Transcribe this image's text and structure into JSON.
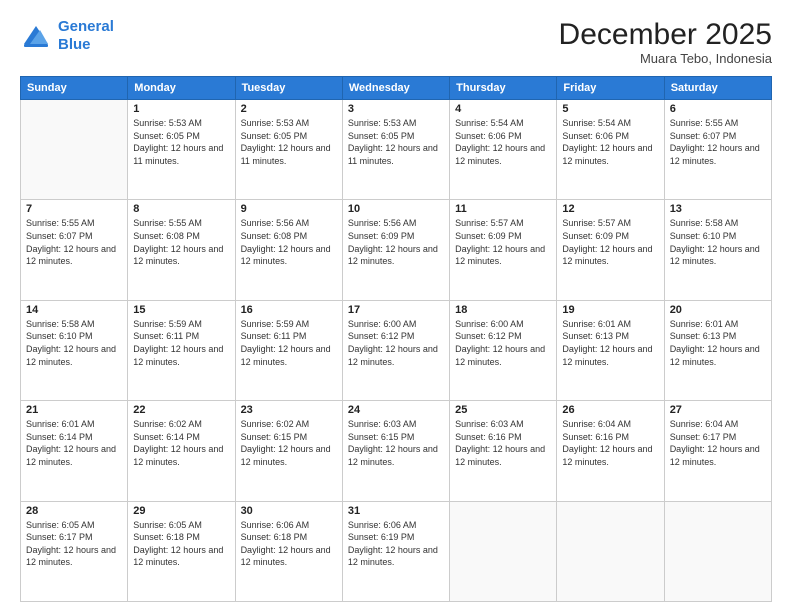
{
  "header": {
    "logo_line1": "General",
    "logo_line2": "Blue",
    "main_title": "December 2025",
    "subtitle": "Muara Tebo, Indonesia"
  },
  "calendar": {
    "days_of_week": [
      "Sunday",
      "Monday",
      "Tuesday",
      "Wednesday",
      "Thursday",
      "Friday",
      "Saturday"
    ],
    "weeks": [
      [
        {
          "day": "",
          "sunrise": "",
          "sunset": "",
          "daylight": ""
        },
        {
          "day": "1",
          "sunrise": "Sunrise: 5:53 AM",
          "sunset": "Sunset: 6:05 PM",
          "daylight": "Daylight: 12 hours and 11 minutes."
        },
        {
          "day": "2",
          "sunrise": "Sunrise: 5:53 AM",
          "sunset": "Sunset: 6:05 PM",
          "daylight": "Daylight: 12 hours and 11 minutes."
        },
        {
          "day": "3",
          "sunrise": "Sunrise: 5:53 AM",
          "sunset": "Sunset: 6:05 PM",
          "daylight": "Daylight: 12 hours and 11 minutes."
        },
        {
          "day": "4",
          "sunrise": "Sunrise: 5:54 AM",
          "sunset": "Sunset: 6:06 PM",
          "daylight": "Daylight: 12 hours and 12 minutes."
        },
        {
          "day": "5",
          "sunrise": "Sunrise: 5:54 AM",
          "sunset": "Sunset: 6:06 PM",
          "daylight": "Daylight: 12 hours and 12 minutes."
        },
        {
          "day": "6",
          "sunrise": "Sunrise: 5:55 AM",
          "sunset": "Sunset: 6:07 PM",
          "daylight": "Daylight: 12 hours and 12 minutes."
        }
      ],
      [
        {
          "day": "7",
          "sunrise": "Sunrise: 5:55 AM",
          "sunset": "Sunset: 6:07 PM",
          "daylight": "Daylight: 12 hours and 12 minutes."
        },
        {
          "day": "8",
          "sunrise": "Sunrise: 5:55 AM",
          "sunset": "Sunset: 6:08 PM",
          "daylight": "Daylight: 12 hours and 12 minutes."
        },
        {
          "day": "9",
          "sunrise": "Sunrise: 5:56 AM",
          "sunset": "Sunset: 6:08 PM",
          "daylight": "Daylight: 12 hours and 12 minutes."
        },
        {
          "day": "10",
          "sunrise": "Sunrise: 5:56 AM",
          "sunset": "Sunset: 6:09 PM",
          "daylight": "Daylight: 12 hours and 12 minutes."
        },
        {
          "day": "11",
          "sunrise": "Sunrise: 5:57 AM",
          "sunset": "Sunset: 6:09 PM",
          "daylight": "Daylight: 12 hours and 12 minutes."
        },
        {
          "day": "12",
          "sunrise": "Sunrise: 5:57 AM",
          "sunset": "Sunset: 6:09 PM",
          "daylight": "Daylight: 12 hours and 12 minutes."
        },
        {
          "day": "13",
          "sunrise": "Sunrise: 5:58 AM",
          "sunset": "Sunset: 6:10 PM",
          "daylight": "Daylight: 12 hours and 12 minutes."
        }
      ],
      [
        {
          "day": "14",
          "sunrise": "Sunrise: 5:58 AM",
          "sunset": "Sunset: 6:10 PM",
          "daylight": "Daylight: 12 hours and 12 minutes."
        },
        {
          "day": "15",
          "sunrise": "Sunrise: 5:59 AM",
          "sunset": "Sunset: 6:11 PM",
          "daylight": "Daylight: 12 hours and 12 minutes."
        },
        {
          "day": "16",
          "sunrise": "Sunrise: 5:59 AM",
          "sunset": "Sunset: 6:11 PM",
          "daylight": "Daylight: 12 hours and 12 minutes."
        },
        {
          "day": "17",
          "sunrise": "Sunrise: 6:00 AM",
          "sunset": "Sunset: 6:12 PM",
          "daylight": "Daylight: 12 hours and 12 minutes."
        },
        {
          "day": "18",
          "sunrise": "Sunrise: 6:00 AM",
          "sunset": "Sunset: 6:12 PM",
          "daylight": "Daylight: 12 hours and 12 minutes."
        },
        {
          "day": "19",
          "sunrise": "Sunrise: 6:01 AM",
          "sunset": "Sunset: 6:13 PM",
          "daylight": "Daylight: 12 hours and 12 minutes."
        },
        {
          "day": "20",
          "sunrise": "Sunrise: 6:01 AM",
          "sunset": "Sunset: 6:13 PM",
          "daylight": "Daylight: 12 hours and 12 minutes."
        }
      ],
      [
        {
          "day": "21",
          "sunrise": "Sunrise: 6:01 AM",
          "sunset": "Sunset: 6:14 PM",
          "daylight": "Daylight: 12 hours and 12 minutes."
        },
        {
          "day": "22",
          "sunrise": "Sunrise: 6:02 AM",
          "sunset": "Sunset: 6:14 PM",
          "daylight": "Daylight: 12 hours and 12 minutes."
        },
        {
          "day": "23",
          "sunrise": "Sunrise: 6:02 AM",
          "sunset": "Sunset: 6:15 PM",
          "daylight": "Daylight: 12 hours and 12 minutes."
        },
        {
          "day": "24",
          "sunrise": "Sunrise: 6:03 AM",
          "sunset": "Sunset: 6:15 PM",
          "daylight": "Daylight: 12 hours and 12 minutes."
        },
        {
          "day": "25",
          "sunrise": "Sunrise: 6:03 AM",
          "sunset": "Sunset: 6:16 PM",
          "daylight": "Daylight: 12 hours and 12 minutes."
        },
        {
          "day": "26",
          "sunrise": "Sunrise: 6:04 AM",
          "sunset": "Sunset: 6:16 PM",
          "daylight": "Daylight: 12 hours and 12 minutes."
        },
        {
          "day": "27",
          "sunrise": "Sunrise: 6:04 AM",
          "sunset": "Sunset: 6:17 PM",
          "daylight": "Daylight: 12 hours and 12 minutes."
        }
      ],
      [
        {
          "day": "28",
          "sunrise": "Sunrise: 6:05 AM",
          "sunset": "Sunset: 6:17 PM",
          "daylight": "Daylight: 12 hours and 12 minutes."
        },
        {
          "day": "29",
          "sunrise": "Sunrise: 6:05 AM",
          "sunset": "Sunset: 6:18 PM",
          "daylight": "Daylight: 12 hours and 12 minutes."
        },
        {
          "day": "30",
          "sunrise": "Sunrise: 6:06 AM",
          "sunset": "Sunset: 6:18 PM",
          "daylight": "Daylight: 12 hours and 12 minutes."
        },
        {
          "day": "31",
          "sunrise": "Sunrise: 6:06 AM",
          "sunset": "Sunset: 6:19 PM",
          "daylight": "Daylight: 12 hours and 12 minutes."
        },
        {
          "day": "",
          "sunrise": "",
          "sunset": "",
          "daylight": ""
        },
        {
          "day": "",
          "sunrise": "",
          "sunset": "",
          "daylight": ""
        },
        {
          "day": "",
          "sunrise": "",
          "sunset": "",
          "daylight": ""
        }
      ]
    ]
  }
}
